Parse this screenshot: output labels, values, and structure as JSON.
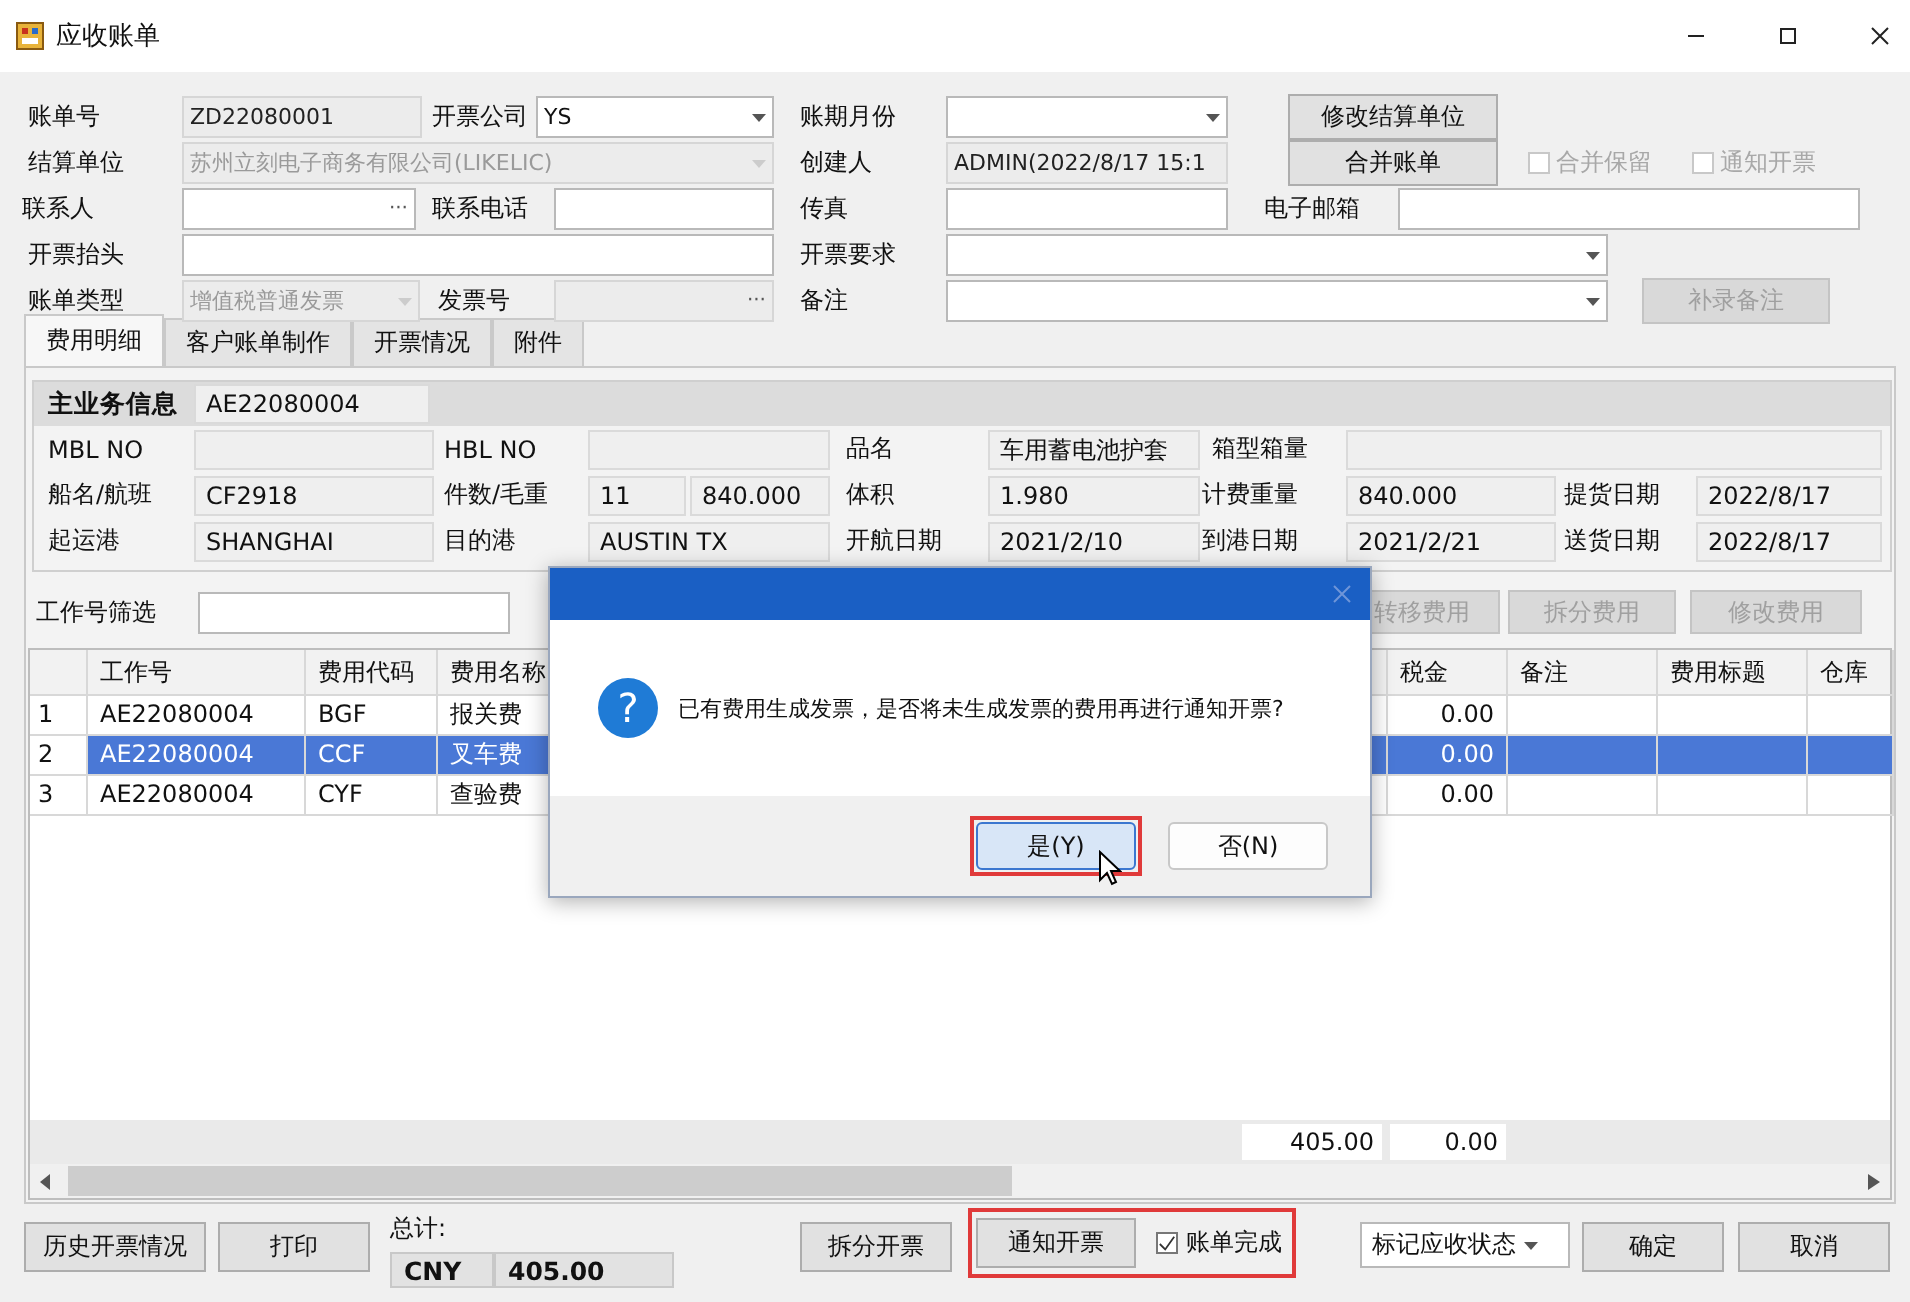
{
  "window": {
    "title": "应收账单"
  },
  "form": {
    "rows": [
      [
        {
          "kind": "label",
          "text": "账单号"
        },
        {
          "kind": "field",
          "value": "ZD22080001",
          "disabled": true
        },
        {
          "kind": "label",
          "text": "开票公司"
        },
        {
          "kind": "select",
          "value": "YS",
          "disabled": false
        },
        {
          "kind": "label",
          "text": "账期月份"
        },
        {
          "kind": "select",
          "disabled": false
        },
        {
          "kind": "button",
          "text": "修改结算单位",
          "disabled": false
        }
      ],
      [
        {
          "kind": "label",
          "text": "结算单位"
        },
        {
          "kind": "select",
          "value": "苏州立刻电子商务有限公司(LIKELIC)",
          "disabled": true
        },
        {
          "kind": "label",
          "text": "创建人"
        },
        {
          "kind": "field",
          "value": "ADMIN(2022/8/17 15:1",
          "disabled": true
        },
        {
          "kind": "button",
          "text": "合并账单",
          "disabled": false
        },
        {
          "kind": "checkbox",
          "text": "合并保留",
          "checked": false,
          "disabled": true
        },
        {
          "kind": "checkbox",
          "text": "通知开票",
          "checked": false,
          "disabled": true
        }
      ],
      [
        {
          "kind": "label",
          "text": "联系人"
        },
        {
          "kind": "field",
          "ellipsis": "···",
          "disabled": false
        },
        {
          "kind": "label",
          "text": "联系电话"
        },
        {
          "kind": "field",
          "disabled": false
        },
        {
          "kind": "label",
          "text": "传真"
        },
        {
          "kind": "field",
          "disabled": false
        },
        {
          "kind": "label",
          "text": "电子邮箱"
        },
        {
          "kind": "field",
          "disabled": false
        }
      ],
      [
        {
          "kind": "label",
          "text": "开票抬头"
        },
        {
          "kind": "field",
          "disabled": false
        },
        {
          "kind": "label",
          "text": "开票要求"
        },
        {
          "kind": "select",
          "disabled": false
        }
      ],
      [
        {
          "kind": "label",
          "text": "账单类型"
        },
        {
          "kind": "select",
          "value": "增值税普通发票",
          "disabled": true
        },
        {
          "kind": "label",
          "text": "发票号"
        },
        {
          "kind": "field",
          "ellipsis": "···",
          "disabled": true
        },
        {
          "kind": "label",
          "text": "备注"
        },
        {
          "kind": "select",
          "disabled": false
        },
        {
          "kind": "button",
          "text": "补录备注",
          "disabled": true
        }
      ]
    ]
  },
  "tabs": [
    {
      "label": "费用明细",
      "selected": true
    },
    {
      "label": "客户账单制作",
      "selected": false
    },
    {
      "label": "开票情况",
      "selected": false
    },
    {
      "label": "附件",
      "selected": false
    }
  ],
  "main_info": {
    "title": "主业务信息",
    "value": "AE22080004",
    "rows": [
      [
        {
          "kind": "label",
          "text": "MBL NO"
        },
        {
          "kind": "field"
        },
        {
          "kind": "label",
          "text": "HBL NO"
        },
        {
          "kind": "field"
        },
        {
          "kind": "label",
          "text": "品名"
        },
        {
          "kind": "field",
          "value": "车用蓄电池护套"
        },
        {
          "kind": "label",
          "text": "箱型箱量"
        },
        {
          "kind": "field"
        }
      ],
      [
        {
          "kind": "label",
          "text": "船名/航班"
        },
        {
          "kind": "field",
          "value": "CF2918"
        },
        {
          "kind": "label",
          "text": "件数/毛重"
        },
        {
          "kind": "field_pair",
          "values": [
            "11",
            "840.000"
          ]
        },
        {
          "kind": "label",
          "text": "体积"
        },
        {
          "kind": "field",
          "value": "1.980"
        },
        {
          "kind": "label",
          "text": "计费重量"
        },
        {
          "kind": "field",
          "value": "840.000"
        },
        {
          "kind": "label",
          "text": "提货日期"
        },
        {
          "kind": "field",
          "value": "2022/8/17"
        }
      ],
      [
        {
          "kind": "label",
          "text": "起运港"
        },
        {
          "kind": "field",
          "value": "SHANGHAI"
        },
        {
          "kind": "label",
          "text": "目的港"
        },
        {
          "kind": "field",
          "value": "AUSTIN TX"
        },
        {
          "kind": "label",
          "text": "开航日期"
        },
        {
          "kind": "field",
          "value": "2021/2/10"
        },
        {
          "kind": "label",
          "text": "到港日期"
        },
        {
          "kind": "field",
          "value": "2021/2/21"
        },
        {
          "kind": "label",
          "text": "送货日期"
        },
        {
          "kind": "field",
          "value": "2022/8/17"
        }
      ]
    ]
  },
  "filter": {
    "label": "工作号筛选",
    "buttons": [
      {
        "text": "转移费用",
        "disabled": true
      },
      {
        "text": "拆分费用",
        "disabled": true
      },
      {
        "text": "修改费用",
        "disabled": true
      }
    ]
  },
  "table": {
    "columns": [
      "工作号",
      "费用代码",
      "费用名称",
      "税金",
      "备注",
      "费用标题",
      "仓库"
    ],
    "rows": [
      {
        "number": "1",
        "job_no": "AE22080004",
        "fee_code": "BGF",
        "fee_name": "报关费",
        "tax": "0.00",
        "selected": false
      },
      {
        "number": "2",
        "job_no": "AE22080004",
        "fee_code": "CCF",
        "fee_name": "叉车费",
        "tax": "0.00",
        "selected": true
      },
      {
        "number": "3",
        "job_no": "AE22080004",
        "fee_code": "CYF",
        "fee_name": "查验费",
        "tax": "0.00",
        "selected": false
      }
    ],
    "totals": [
      "405.00",
      "0.00"
    ]
  },
  "footer": {
    "history_button": "历史开票情况",
    "print_button": "打印",
    "total_label": "总计:",
    "currency": "CNY",
    "total": "405.00",
    "split_button": "拆分开票",
    "notify_group": {
      "highlighted": true,
      "button": "通知开票",
      "checkbox": {
        "label": "账单完成",
        "checked": true
      }
    },
    "status_select": "标记应收状态",
    "ok_button": "确定",
    "cancel_button": "取消"
  },
  "dialog": {
    "icon": "?",
    "message": "已有费用生成发票，是否将未生成发票的费用再进行通知开票?",
    "buttons": [
      {
        "label": "是(Y)",
        "highlighted": true
      },
      {
        "label": "否(N)",
        "highlighted": false
      }
    ]
  }
}
